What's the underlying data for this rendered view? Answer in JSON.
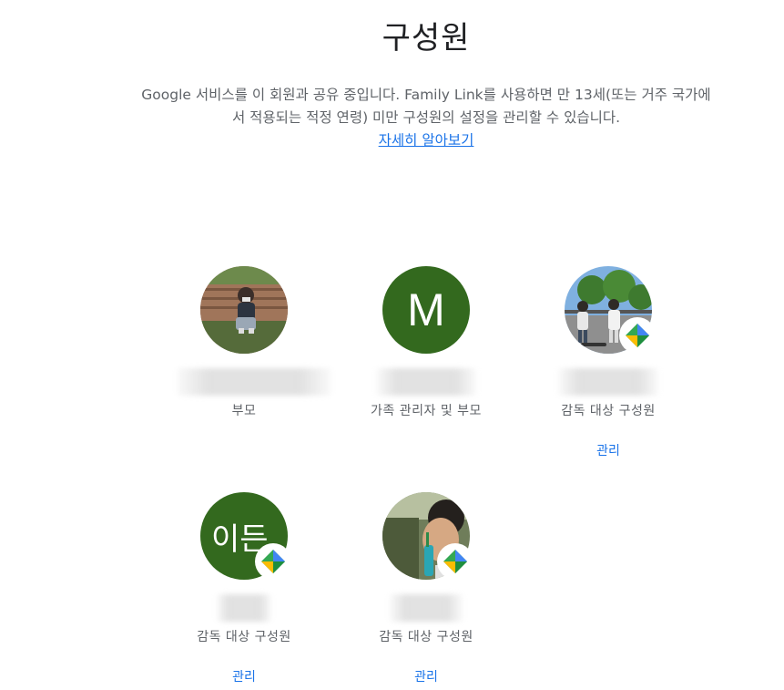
{
  "page": {
    "title": "구성원",
    "intro": "Google 서비스를 이 회원과 공유 중입니다. Family Link를 사용하면 만 13세(또는 거주 국가에서 적용되는 적정 연령) 미만 구성원의 설정을 관리할 수 있습니다.",
    "learn_more": "자세히 알아보기"
  },
  "members": [
    {
      "avatar": "photo-child-bench",
      "role": "부모",
      "manage": ""
    },
    {
      "avatar": "letter",
      "initial": "M",
      "role": "가족 관리자 및 부모",
      "manage": ""
    },
    {
      "avatar": "photo-two-children",
      "badge": "family-link-icon",
      "role": "감독 대상 구성원",
      "manage": "관리"
    },
    {
      "avatar": "letter",
      "initial": "이든",
      "badge": "family-link-icon",
      "role": "감독 대상 구성원",
      "manage": "관리"
    },
    {
      "avatar": "photo-child-drink",
      "badge": "family-link-icon",
      "role": "감독 대상 구성원",
      "manage": "관리"
    }
  ],
  "colors": {
    "letter_avatar_bg": "#33691e",
    "link": "#1a73e8",
    "muted_text": "#5f6368"
  }
}
